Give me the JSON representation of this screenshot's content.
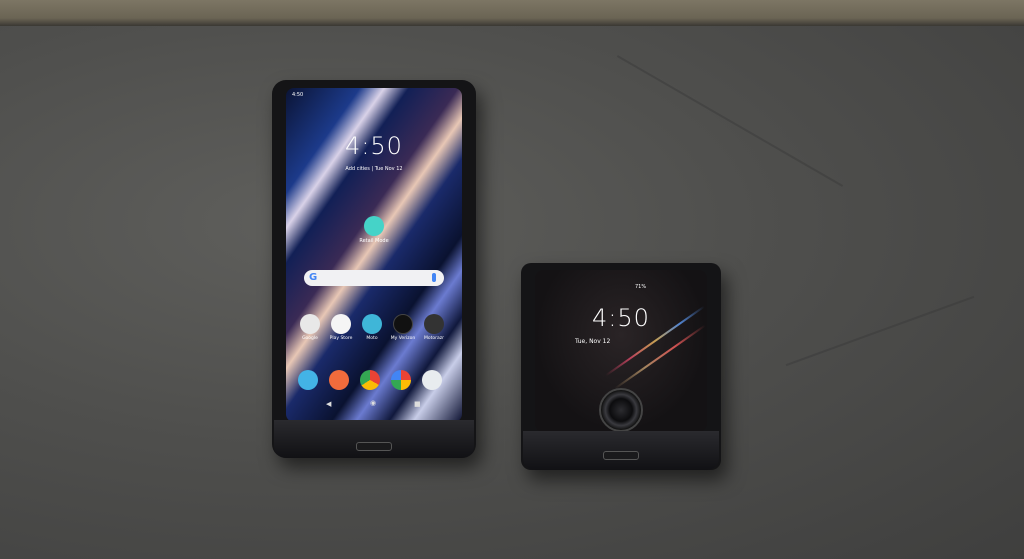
{
  "scene": {
    "surface_color": "#4f4f4d",
    "phone_color": "#141416"
  },
  "large_phone": {
    "status_time": "4:50",
    "clock": "4:50",
    "subtitle": "Add cities  |  Tue Nov 12",
    "retail_mode_label": "Retail Mode",
    "search_logo": "G",
    "apps": [
      {
        "label": "Google",
        "color": "#e8e8e8"
      },
      {
        "label": "Play Store",
        "color": "#f5f5f5"
      },
      {
        "label": "Moto",
        "color": "#3fb6d8"
      },
      {
        "label": "My Verizon",
        "color": "#111111"
      },
      {
        "label": "Motorazr",
        "color": "#333333"
      }
    ],
    "dock": [
      {
        "icon": "phone-icon",
        "color": "#43b3e6"
      },
      {
        "icon": "messages-icon",
        "color": "#f06b3c"
      },
      {
        "icon": "chrome-icon",
        "color": "#35a853"
      },
      {
        "icon": "photos-icon",
        "color": "#f4f4f4"
      },
      {
        "icon": "camera-icon",
        "color": "#e8ecef"
      }
    ],
    "nav": {
      "back": "◀",
      "home": "◉",
      "recent": "■"
    }
  },
  "small_phone": {
    "status": "71%",
    "clock": "4:50",
    "date": "Tue, Nov 12"
  }
}
